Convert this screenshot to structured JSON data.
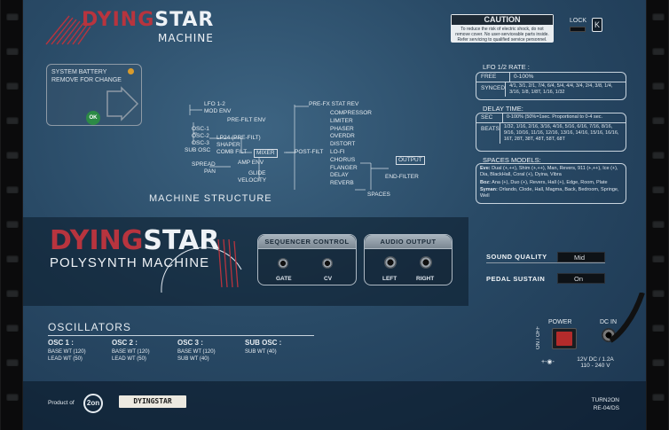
{
  "header": {
    "logo_word1": "DYING",
    "logo_word2": "STAR",
    "logo_sub": "MACHINE"
  },
  "caution": {
    "title": "CAUTION",
    "text": "To reduce the risk of electric shock, do not remove cover. No user-serviceable parts inside. Refer servicing to qualified service personnel."
  },
  "lock": {
    "label": "LOCK",
    "key": "K"
  },
  "battery": {
    "line1": "SYSTEM BATTERY",
    "line2": "REMOVE FOR CHANGE",
    "badge": "OK"
  },
  "structure": {
    "title": "MACHINE STRUCTURE",
    "left": [
      "LFO 1-2",
      "MOD ENV"
    ],
    "pre_filt_env": "PRE-FILT ENV",
    "osc": [
      "OSC-1",
      "OSC-2",
      "OSC-3",
      "SUB OSC"
    ],
    "mid": [
      "LP24 (PRE-FILT)",
      "SHAPER",
      "COMB FILT"
    ],
    "mixer": "MIXER",
    "post_filt": "POST-FILT",
    "spread": [
      "SPREAD",
      "PAN"
    ],
    "mod": [
      "AMP ENV",
      "GLIDE",
      "VELOCITY"
    ],
    "prefx": "PRE-FX STAT REV",
    "fx": [
      "COMPRESSOR",
      "LIMITER",
      "PHASER",
      "OVERDR",
      "DISTORT",
      "LO-FI",
      "CHORUS",
      "FLANGER",
      "DELAY",
      "REVERB"
    ],
    "output": "OUTPUT",
    "end_filter": "END-FILTER",
    "spaces": "SPACES"
  },
  "lfo_rate": {
    "title": "LFO 1/2 RATE :",
    "rows": [
      {
        "k": "FREE",
        "v": "0-100%"
      },
      {
        "k": "SYNCED",
        "v": "4/1, 3/1, 2/1, 7/4, 6/4, 5/4, 4/4, 3/4, 2/4, 3/8, 1/4, 3/16, 1/8, 1/8T, 1/16, 1/32"
      }
    ]
  },
  "delay_time": {
    "title": "DELAY TIME:",
    "rows": [
      {
        "k": "SEC",
        "v": "0-100% (50%=1sec. Proportional to 0-4 sec."
      },
      {
        "k": "BEATS",
        "v": "1/32, 1/16, 2/16, 3/16, 4/16, 5/16, 6/16, 7/16, 8/16, 9/16, 10/16, 11/16, 12/16, 13/16, 14/16, 15/16, 16/16, 16T, 28T, 38T, 48T, 58T, 68T"
      }
    ]
  },
  "spaces_models": {
    "title": "SPACES MODELS:",
    "rows": [
      {
        "k": "Eve:",
        "v": "Dual (+,++), Shim (+,++), Man, Revers, 911 (+,++), Ice (+), Dia, BlackHall, Coral (+), Dyina, Vibra"
      },
      {
        "k": "Boz:",
        "v": "Ana (+), Duo (+), Revers, Hall (+), Edge, Room, Plate"
      },
      {
        "k": "Syman:",
        "v": "Orlando, Clode, Hall, Magma, Back, Bedroom, Springe, Well"
      }
    ]
  },
  "logo2": {
    "word1": "DYING",
    "word2": "STAR",
    "sub": "POLYSYNTH MACHINE"
  },
  "sequencer": {
    "title": "SEQUENCER CONTROL",
    "jack1": "GATE",
    "jack2": "CV"
  },
  "audio": {
    "title": "AUDIO OUTPUT",
    "jack1": "LEFT",
    "jack2": "RIGHT"
  },
  "settings": {
    "sound_quality_label": "SOUND QUALITY",
    "sound_quality_value": "Mid",
    "pedal_sustain_label": "PEDAL SUSTAIN",
    "pedal_sustain_value": "On"
  },
  "oscillators": {
    "title": "OSCILLATORS",
    "cols": [
      {
        "h": "OSC 1 :",
        "l1": "BASE WT (120)",
        "l2": "LEAD WT (50)"
      },
      {
        "h": "OSC 2 :",
        "l1": "BASE WT (120)",
        "l2": "LEAD WT (50)"
      },
      {
        "h": "OSC 3 :",
        "l1": "BASE WT (120)",
        "l2": "SUB WT (40)"
      },
      {
        "h": "SUB OSC :",
        "l1": "SUB WT (40)",
        "l2": ""
      }
    ]
  },
  "power": {
    "label": "POWER",
    "dc_in": "DC IN",
    "on_off": "ON / OFF",
    "spec1": "12V DC / 1.2A",
    "spec2": "110 - 240 V"
  },
  "footer": {
    "product_of": "Product of",
    "brand_badge": "2on",
    "name_plate": "DYINGSTAR",
    "maker": "TURN2ON",
    "model": "RE-04/DS"
  },
  "colors": {
    "panel": "#294a66",
    "accent_red": "#b8343e",
    "line": "#c8d4de"
  }
}
